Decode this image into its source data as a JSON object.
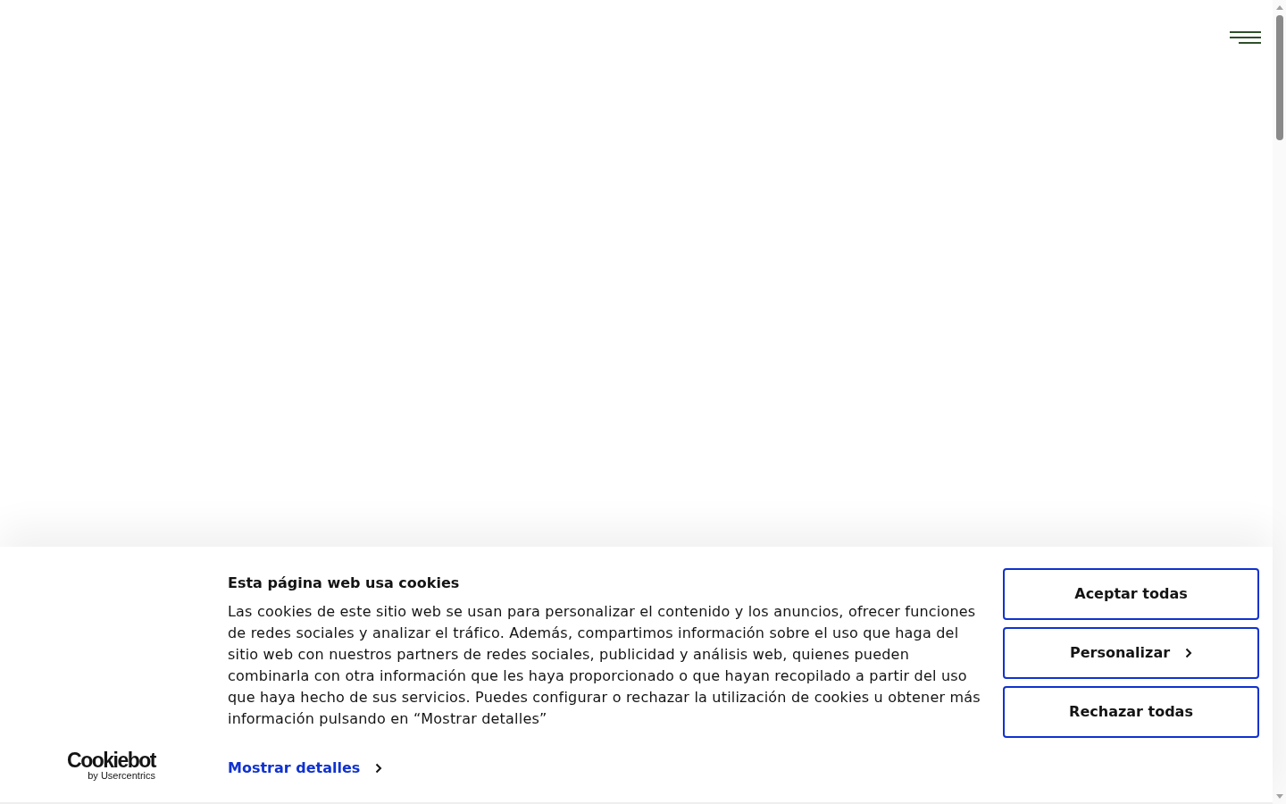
{
  "cookie_banner": {
    "logo": {
      "name": "Cookiebot",
      "byline": "by Usercentrics"
    },
    "title": "Esta página web usa cookies",
    "body": "Las cookies de este sitio web se usan para personalizar el contenido y los anuncios, ofrecer funciones de redes sociales y analizar el tráfico. Además, compartimos información sobre el uso que haga del sitio web con nuestros partners de redes sociales, publicidad y análisis web, quienes pueden combinarla con otra información que les haya proporcionado o que hayan recopilado a partir del uso que haya hecho de sus servicios. Puedes configurar o rechazar la utilización de cookies u obtener más información pulsando en “Mostrar detalles”",
    "details_link": "Mostrar detalles",
    "buttons": [
      {
        "label": "Aceptar todas",
        "kind": "plain"
      },
      {
        "label": "Personalizar",
        "kind": "more"
      },
      {
        "label": "Rechazar todas",
        "kind": "plain"
      }
    ]
  }
}
